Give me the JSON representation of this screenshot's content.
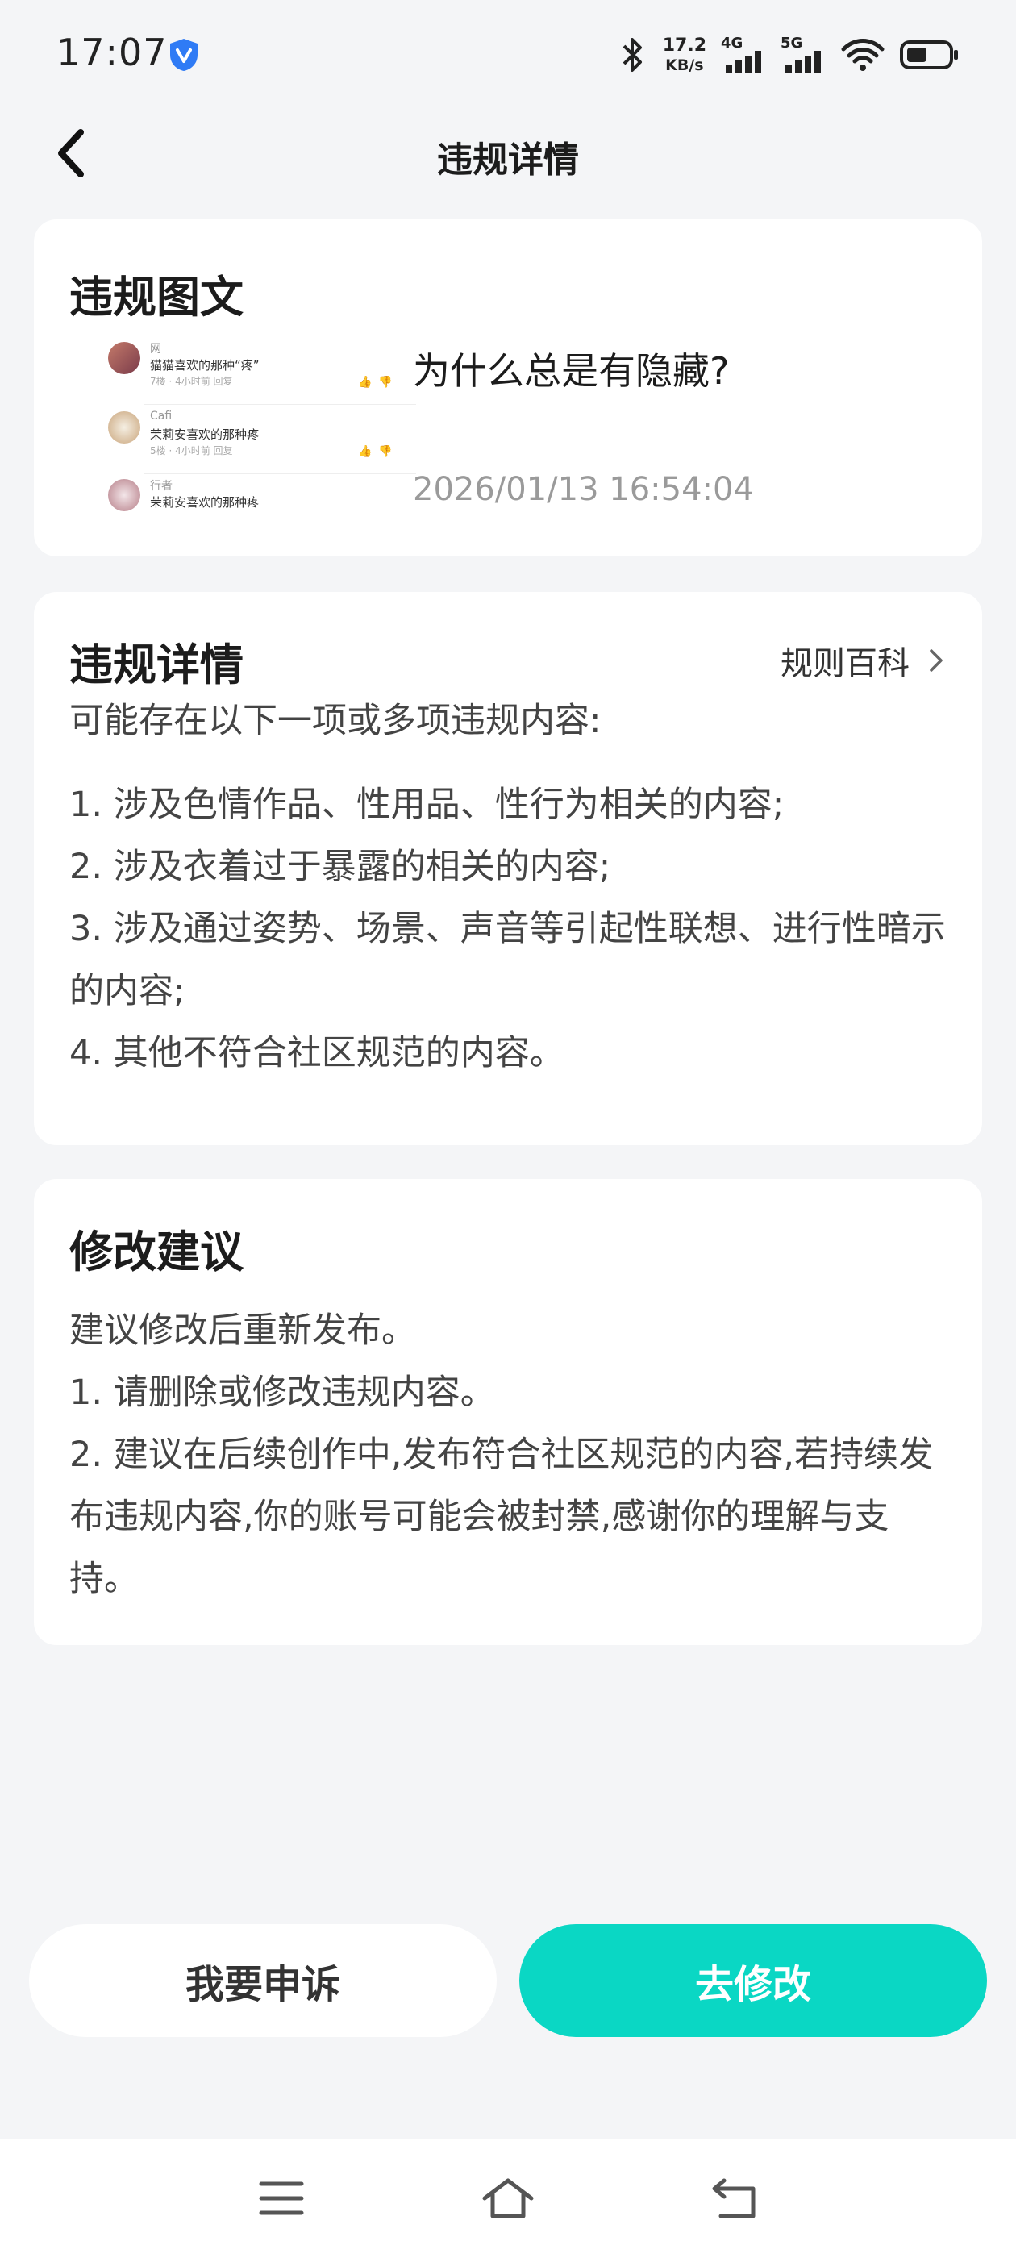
{
  "status_bar": {
    "time": "17:07",
    "net_speed_value": "17.2",
    "net_speed_unit": "KB/s",
    "sim1_label": "4G",
    "sim2_label": "5G",
    "icons": [
      "shield-icon",
      "bluetooth-icon",
      "signal-icon",
      "wifi-icon",
      "battery-icon"
    ]
  },
  "header": {
    "title": "违规详情"
  },
  "violation_post": {
    "heading": "违规图文",
    "thumbnail": [
      {
        "name": "网",
        "text": "猫猫喜欢的那种“疼”",
        "meta": "7楼 · 4小时前  回复"
      },
      {
        "name": "Cafi",
        "text": "茉莉安喜欢的那种疼",
        "meta": "5楼 · 4小时前  回复"
      },
      {
        "name": "行者",
        "text": "茉莉安喜欢的那种疼",
        "meta": ""
      }
    ],
    "title": "为什么总是有隐藏?",
    "date": "2026/01/13 16:54:04"
  },
  "violation_detail": {
    "heading": "违规详情",
    "rule_link": "规则百科",
    "intro": "可能存在以下一项或多项违规内容:",
    "items": [
      "1. 涉及色情作品、性用品、性行为相关的内容;",
      "2. 涉及衣着过于暴露的相关的内容;",
      "3. 涉及通过姿势、场景、声音等引起性联想、进行性暗示的内容;",
      "4. 其他不符合社区规范的内容。"
    ]
  },
  "suggestion": {
    "heading": "修改建议",
    "lines": [
      "建议修改后重新发布。",
      "1. 请删除或修改违规内容。",
      "2. 建议在后续创作中,发布符合社区规范的内容,若持续发布违规内容,你的账号可能会被封禁,感谢你的理解与支持。"
    ]
  },
  "actions": {
    "appeal": "我要申诉",
    "edit": "去修改"
  },
  "colors": {
    "accent": "#0ad7c4",
    "background": "#F4F5F7"
  }
}
